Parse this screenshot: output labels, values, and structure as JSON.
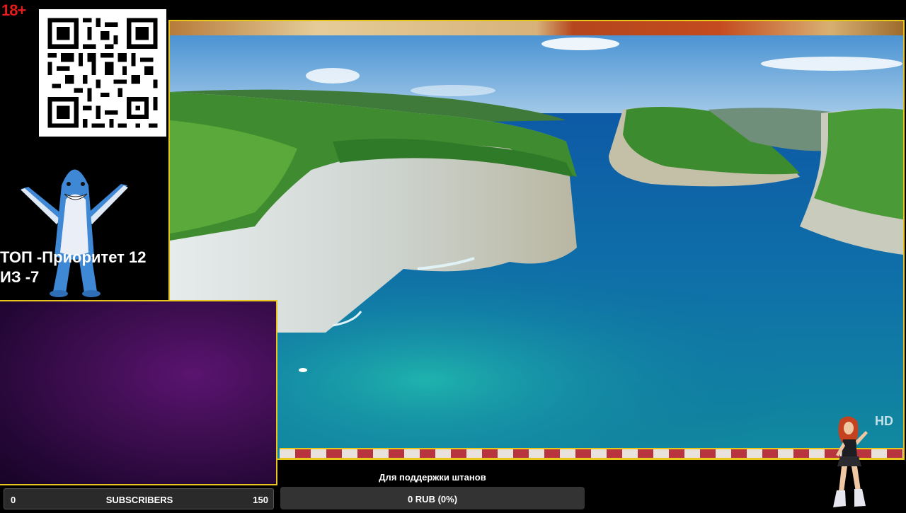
{
  "badge": {
    "age": "18+"
  },
  "priority": {
    "line1": "ТОП -Приоритет 12",
    "line2": "ИЗ -7"
  },
  "video": {
    "quality_badge": "HD"
  },
  "subscribers": {
    "current": "0",
    "label": "SUBSCRIBERS",
    "goal": "150"
  },
  "donation": {
    "title": "Для поддержки штанов",
    "amount": "0 RUB (0%)",
    "progress": 0
  },
  "colors": {
    "accent": "#e8c61e",
    "age_badge": "#e31b1b",
    "cam_bg": "#3b0d4d"
  },
  "icons": {
    "mascot": "dancing-shark",
    "dancer": "dancing-girl",
    "qr": "qr-code"
  }
}
